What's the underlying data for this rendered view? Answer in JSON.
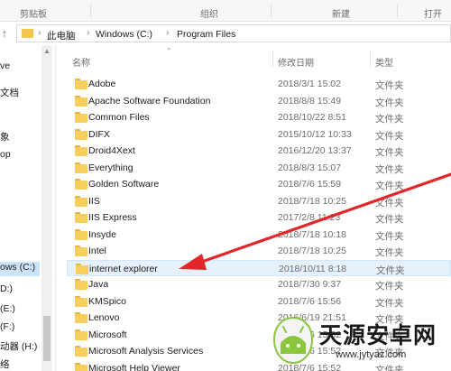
{
  "ribbon": {
    "groups": [
      "剪贴板",
      "组织",
      "新建",
      "打开"
    ]
  },
  "address": {
    "crumbs": [
      "此电脑",
      "Windows (C:)",
      "Program Files"
    ]
  },
  "nav": {
    "items": [
      "ve",
      "文档",
      "象",
      "op",
      "ows (C:)",
      "D:)",
      "(E:)",
      "(F:)",
      "动器 (H:)",
      "络"
    ]
  },
  "columns": {
    "name": "名称",
    "date": "修改日期",
    "type": "类型"
  },
  "files": [
    {
      "name": "Adobe",
      "date": "2018/3/1 15:02",
      "type": "文件夹"
    },
    {
      "name": "Apache Software Foundation",
      "date": "2018/8/8 15:49",
      "type": "文件夹"
    },
    {
      "name": "Common Files",
      "date": "2018/10/22 8:51",
      "type": "文件夹"
    },
    {
      "name": "DIFX",
      "date": "2015/10/12 10:33",
      "type": "文件夹"
    },
    {
      "name": "Droid4Xext",
      "date": "2016/12/20 13:37",
      "type": "文件夹"
    },
    {
      "name": "Everything",
      "date": "2018/8/3 15:07",
      "type": "文件夹"
    },
    {
      "name": "Golden Software",
      "date": "2018/7/6 15:59",
      "type": "文件夹"
    },
    {
      "name": "IIS",
      "date": "2018/7/18 10:25",
      "type": "文件夹"
    },
    {
      "name": "IIS Express",
      "date": "2017/2/8 11:23",
      "type": "文件夹"
    },
    {
      "name": "Insyde",
      "date": "2018/7/18 10:18",
      "type": "文件夹"
    },
    {
      "name": "Intel",
      "date": "2018/7/18 10:25",
      "type": "文件夹"
    },
    {
      "name": "internet explorer",
      "date": "2018/10/11 8:18",
      "type": "文件夹"
    },
    {
      "name": "Java",
      "date": "2018/7/30 9:37",
      "type": "文件夹"
    },
    {
      "name": "KMSpico",
      "date": "2018/7/6 15:56",
      "type": "文件夹"
    },
    {
      "name": "Lenovo",
      "date": "2016/6/19 21:51",
      "type": "文件夹"
    },
    {
      "name": "Microsoft",
      "date": "2018/7/6 15:52",
      "type": "文件夹"
    },
    {
      "name": "Microsoft Analysis Services",
      "date": "2018/7/6 15:52",
      "type": "文件夹"
    },
    {
      "name": "Microsoft Help Viewer",
      "date": "2018/7/6 15:52",
      "type": "文件夹"
    }
  ],
  "selected_index": 11,
  "colors": {
    "folder": "#f6cf5c",
    "selection": "#e5f1fb",
    "annotation_arrow": "#e3262a"
  },
  "watermark": {
    "brand": "天源安卓网",
    "url": "www.jytyaz.com"
  }
}
